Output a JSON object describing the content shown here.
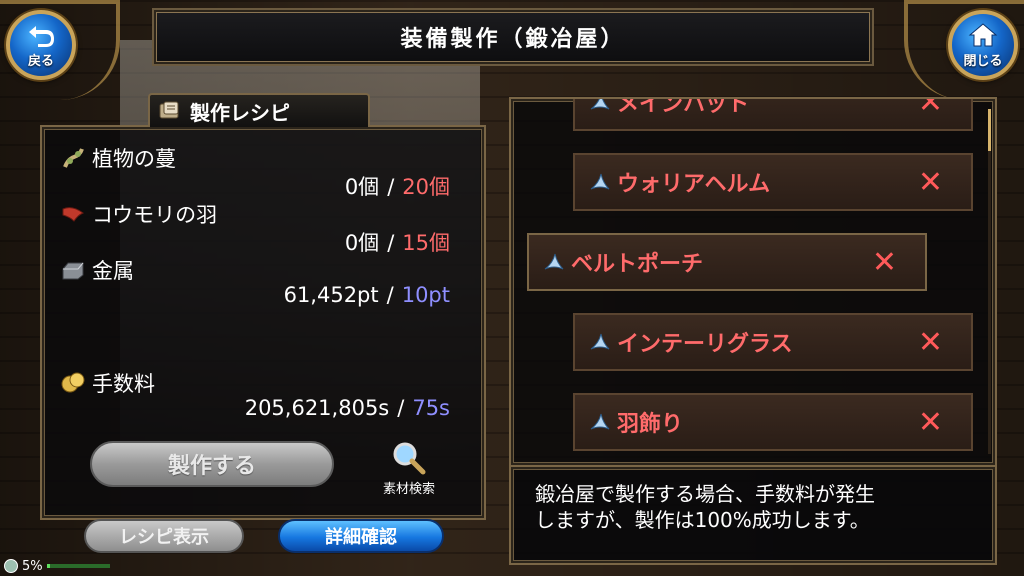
{
  "header": {
    "title": "装備製作（鍛冶屋）",
    "back_label": "戻る",
    "close_label": "閉じる"
  },
  "recipe": {
    "tab_label": "製作レシピ",
    "materials": [
      {
        "name": "植物の蔓",
        "have": "0個",
        "need": "20個",
        "need_color": "#ff6b6b",
        "icon": "vine-icon"
      },
      {
        "name": "コウモリの羽",
        "have": "0個",
        "need": "15個",
        "need_color": "#ff6b6b",
        "icon": "bat-wing-icon"
      },
      {
        "name": "金属",
        "have": "61,452pt",
        "need": "10pt",
        "need_color": "#8f8fff",
        "icon": "metal-ingot-icon"
      }
    ],
    "fee": {
      "name": "手数料",
      "have": "205,621,805s",
      "need": "75s",
      "icon": "coins-icon"
    },
    "separator": "/",
    "craft_label": "製作する",
    "search_label": "素材検索"
  },
  "bottom": {
    "recipe_view_label": "レシピ表示",
    "detail_label": "詳細確認",
    "status_percent": "5%"
  },
  "equipment_list": [
    {
      "name": "メインハット",
      "selected": false,
      "partial": true
    },
    {
      "name": "ウォリアヘルム",
      "selected": false
    },
    {
      "name": "ベルトポーチ",
      "selected": true
    },
    {
      "name": "インテーリグラス",
      "selected": false
    },
    {
      "name": "羽飾り",
      "selected": false
    }
  ],
  "description": {
    "line1": "鍛冶屋で製作する場合、手数料が発生",
    "line2": "しますが、製作は100%成功します。"
  },
  "colors": {
    "accent_gold": "#b59049",
    "need_red": "#ff6b6b",
    "need_blue": "#8f8fff",
    "list_text_red": "#ff6b6b"
  }
}
